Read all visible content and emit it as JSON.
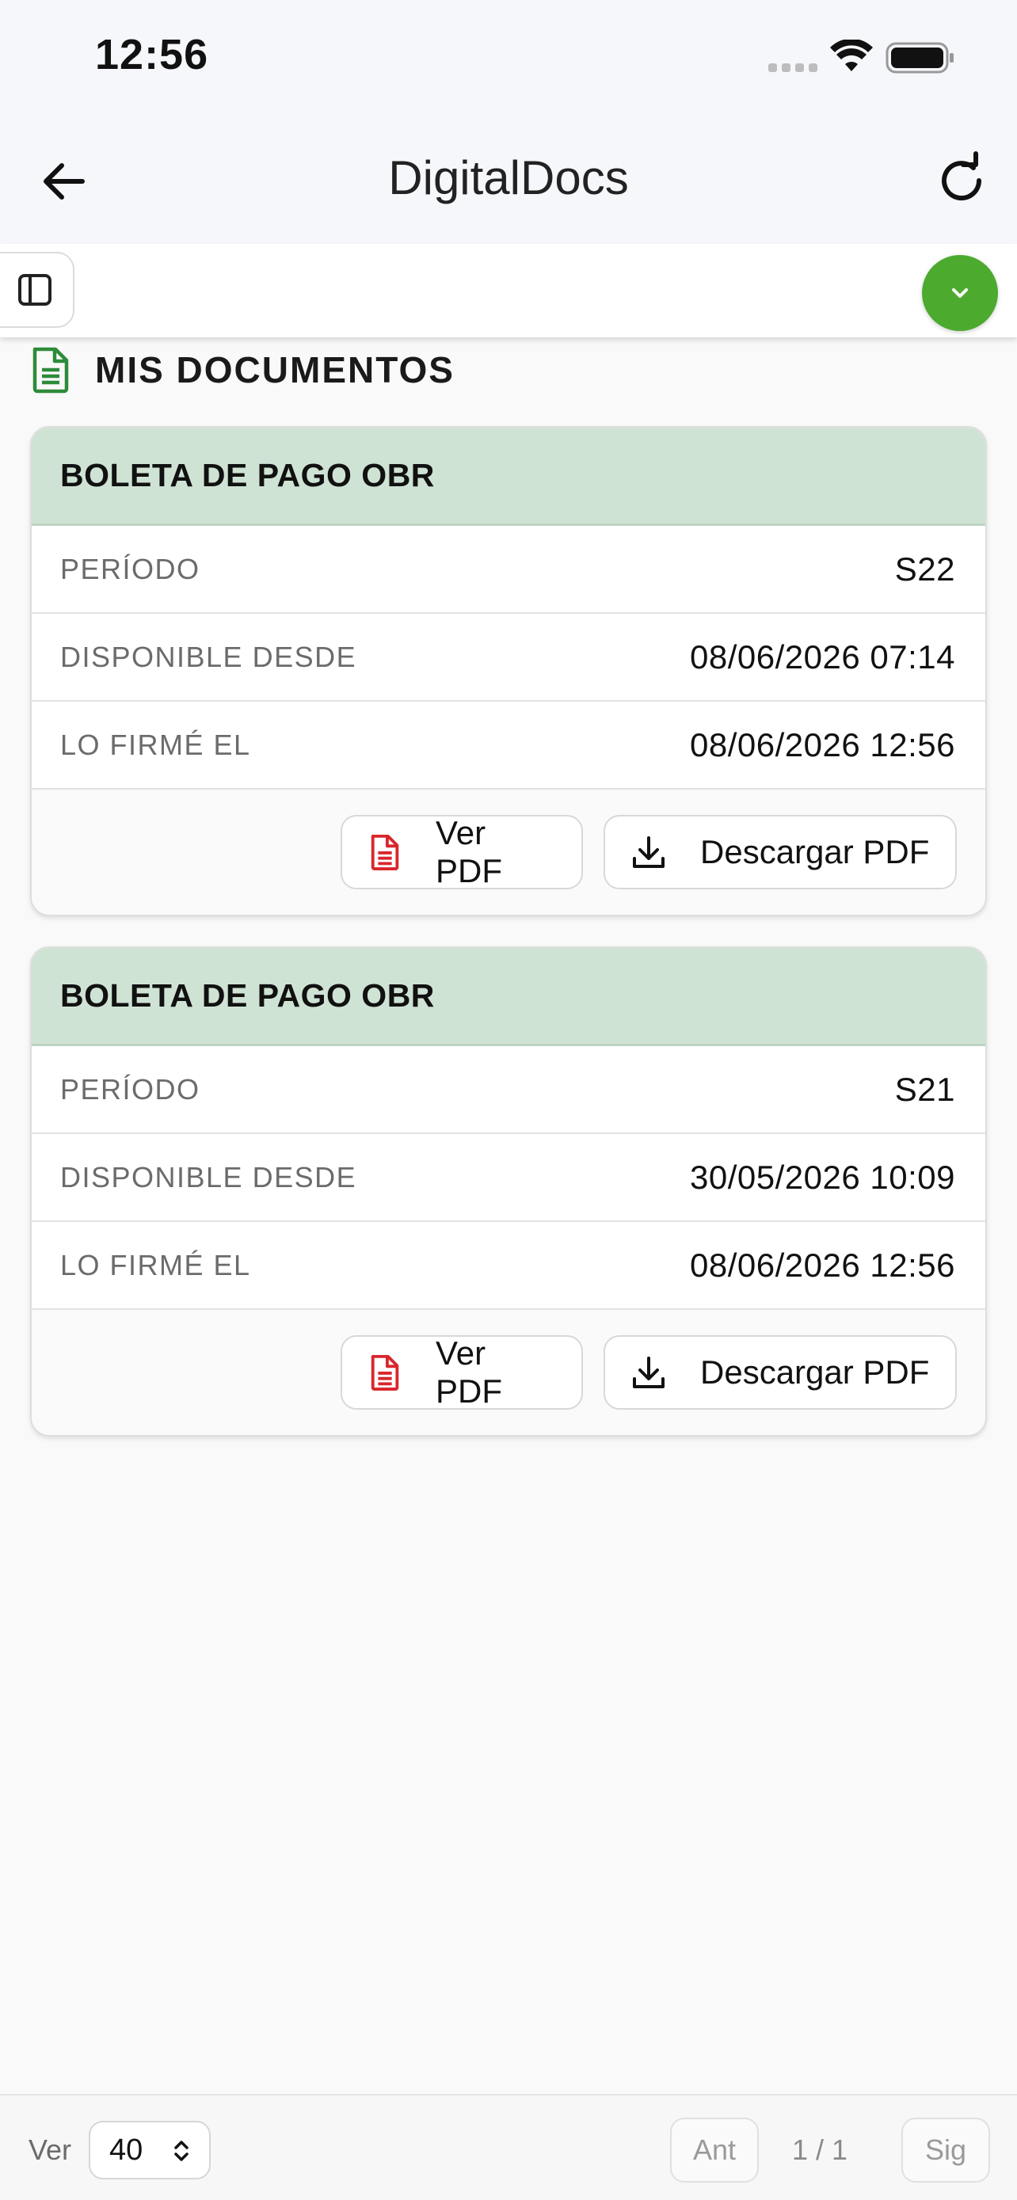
{
  "status_bar": {
    "time": "12:56"
  },
  "header": {
    "title": "DigitalDocs"
  },
  "section": {
    "title": "MIS DOCUMENTOS"
  },
  "documents": [
    {
      "title": "BOLETA DE PAGO OBR",
      "rows": [
        {
          "label": "PERÍODO",
          "value": "S22"
        },
        {
          "label": "DISPONIBLE DESDE",
          "value": "08/06/2026 07:14"
        },
        {
          "label": "LO FIRMÉ EL",
          "value": "08/06/2026 12:56"
        }
      ],
      "view_label": "Ver PDF",
      "download_label": "Descargar PDF"
    },
    {
      "title": "BOLETA DE PAGO OBR",
      "rows": [
        {
          "label": "PERÍODO",
          "value": "S21"
        },
        {
          "label": "DISPONIBLE DESDE",
          "value": "30/05/2026 10:09"
        },
        {
          "label": "LO FIRMÉ EL",
          "value": "08/06/2026 12:56"
        }
      ],
      "view_label": "Ver PDF",
      "download_label": "Descargar PDF"
    }
  ],
  "footer": {
    "ver_label": "Ver",
    "page_size": "40",
    "prev_label": "Ant",
    "page_indicator": "1 / 1",
    "next_label": "Sig"
  },
  "colors": {
    "accent_green": "#4caa2e",
    "card_header": "#cfe3d4",
    "doc_icon_green": "#2e8b3a",
    "pdf_icon_red": "#d9262c"
  },
  "icons": {
    "back": "arrow-left-icon",
    "refresh": "refresh-icon",
    "sidebar": "sidebar-toggle-icon",
    "collapse": "chevron-down-icon",
    "section": "document-icon",
    "view": "pdf-file-icon",
    "download": "download-icon"
  }
}
